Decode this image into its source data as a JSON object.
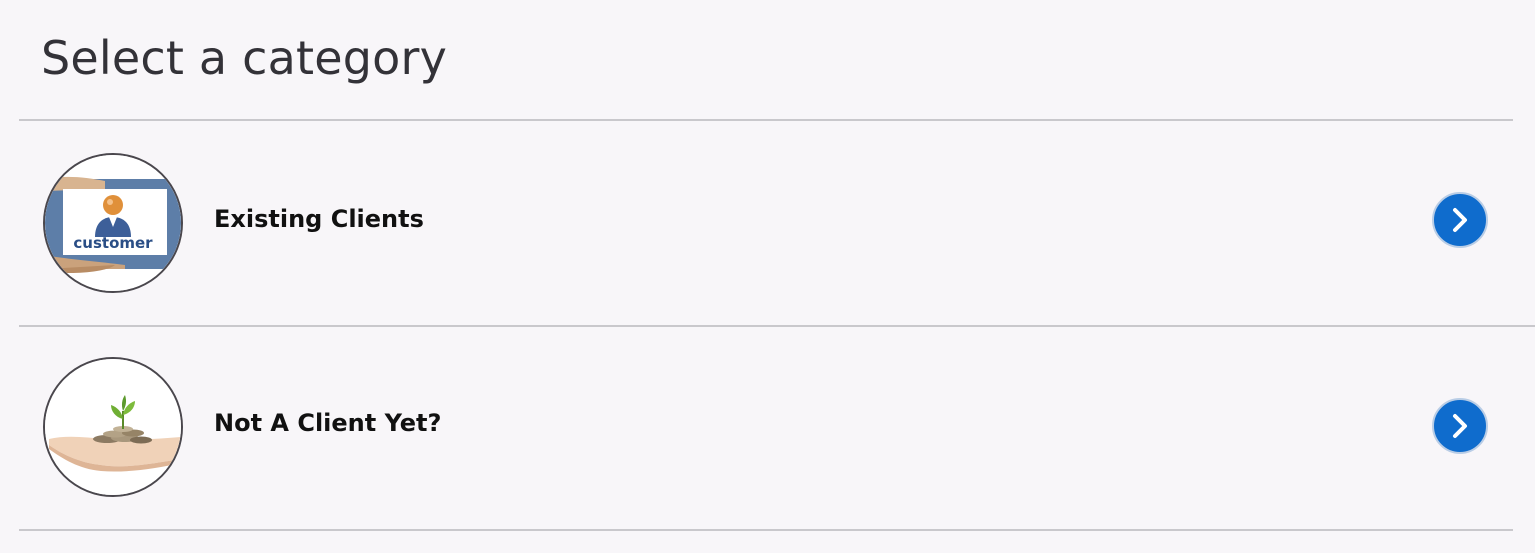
{
  "header": {
    "title": "Select a category"
  },
  "categories": [
    {
      "label": "Existing Clients",
      "image_icon": "customer-card-icon",
      "image_text": "customer"
    },
    {
      "label": "Not A Client Yet?",
      "image_icon": "hand-coins-sprout-icon"
    }
  ],
  "icons": {
    "next": "chevron-right-icon"
  },
  "colors": {
    "accent": "#0f6ccd",
    "background": "#f8f6f9",
    "title_text": "#333238",
    "divider": "#c9c8cc"
  }
}
